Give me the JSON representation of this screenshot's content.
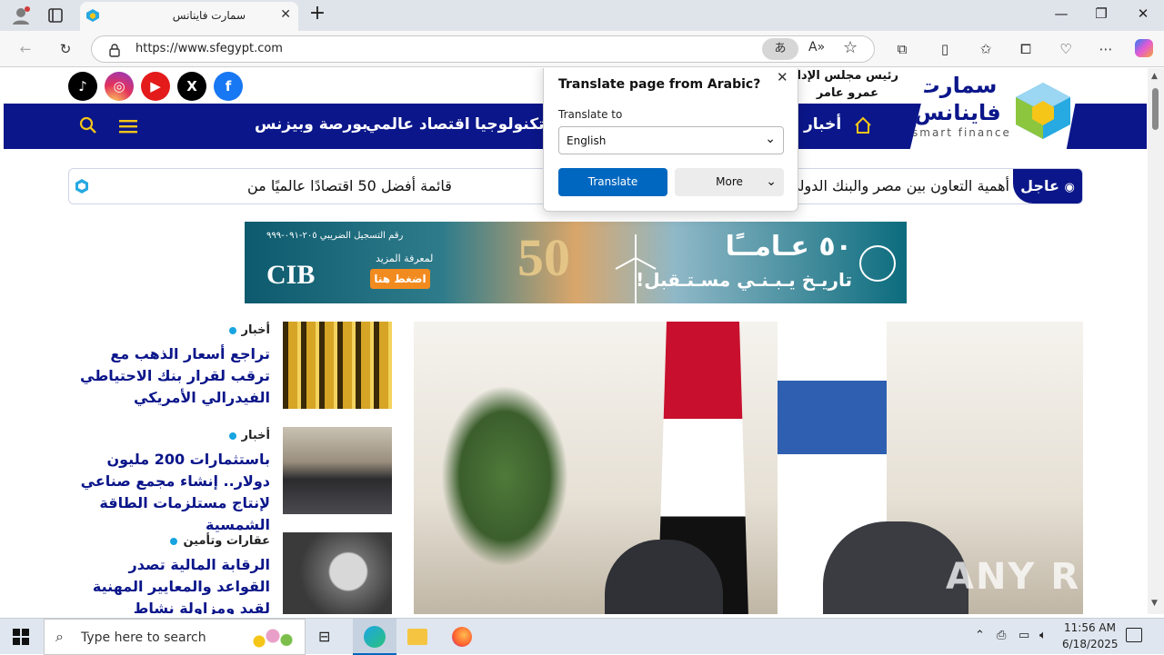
{
  "browser": {
    "tab_title": "سمارت فاينانس",
    "tab_close": "✕",
    "new_tab": "+",
    "minimize": "—",
    "maximize": "❐",
    "close": "✕",
    "url": "https://www.sfegypt.com",
    "icons": [
      "profile-icon",
      "tabs-icon",
      "back-icon",
      "refresh-icon",
      "lock-icon",
      "translate-icon",
      "read-aloud-icon",
      "favorite-star-icon",
      "extensions-icon",
      "split-screen-icon",
      "favorites-icon",
      "collections-icon",
      "browser-essentials-icon",
      "more-icon",
      "copilot-icon"
    ]
  },
  "site": {
    "social": [
      "tiktok",
      "instagram",
      "youtube",
      "x",
      "facebook"
    ],
    "chairman_label": "رئيس مجلس الإدارة",
    "chairman_name": "عمرو عامر",
    "logo_ar": "سمارت فاينانس",
    "logo_en": "smart finance",
    "nav": {
      "home_icon": "home-icon",
      "items": [
        "أخبار",
        "وتكنولوجيا",
        "اقتصاد عالمي",
        "بورصة وبيزنس"
      ],
      "menu_icon": "menu-icon",
      "search_icon": "search-icon"
    },
    "ticker": {
      "label": "عاجل",
      "text": "أهمية التعاون بين مصر والبنك الدولي لدفع جهود تحقيق الأمن الغذائي",
      "text_left": "قائمة أفضل 50 اقتصادًا عالميًا من"
    },
    "banner": {
      "title": "٥٠ عـامــًا",
      "subtitle": "تاريـخ يـبـنـي مسـتـقبل!",
      "brand": "CIB",
      "more": "لمعرفة المزيد",
      "cta": "اضغط هنا",
      "hotline": "رقم التسجيل الضريبي ٢٠٥-٠٩١-٩٩٩"
    },
    "stories": [
      {
        "category": "أخبار",
        "headline": "تراجع أسعار الذهب مع ترقب لقرار بنك الاحتياطي الفيدرالي الأمريكي"
      },
      {
        "category": "أخبار",
        "headline": "باستثمارات 200 مليون دولار.. إنشاء مجمع صناعي لإنتاج مستلزمات الطاقة الشمسية"
      },
      {
        "category": "عقارات وتأمين",
        "headline": "الرقابة المالية تصدر القواعد والمعايير المهنية لقيد ومزاولة نشاط الوساطة فى التأمين أو"
      }
    ],
    "watermark": "ANY RUN"
  },
  "translate_popup": {
    "title": "Translate page from Arabic?",
    "label": "Translate to",
    "selected_language": "English",
    "translate_button": "Translate",
    "more_button": "More",
    "close": "✕"
  },
  "taskbar": {
    "search_placeholder": "Type here to search",
    "time": "11:56 AM",
    "date": "6/18/2025"
  },
  "colors": {
    "nav_blue": "#0b168a",
    "accent_blue": "#18a4e0",
    "translate_blue": "#0067c0"
  }
}
